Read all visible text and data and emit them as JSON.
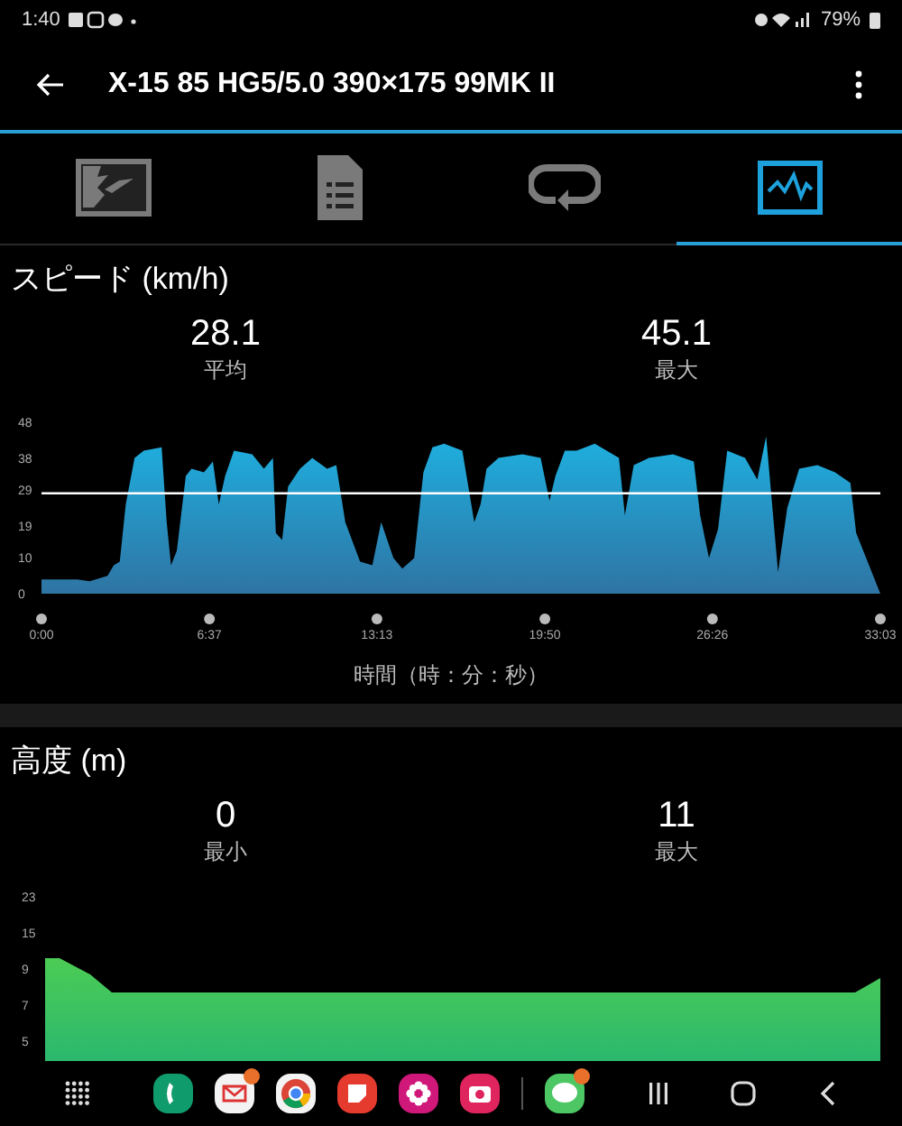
{
  "status_bar": {
    "time": "1:40",
    "battery": "79%"
  },
  "app_bar": {
    "title": "X-15 85 HG5/5.0 390×175 99MK II"
  },
  "tabs": [
    {
      "kind": "map",
      "selected": false
    },
    {
      "kind": "report",
      "selected": false
    },
    {
      "kind": "laps",
      "selected": false
    },
    {
      "kind": "graph",
      "selected": true
    }
  ],
  "speed": {
    "title": "スピード (km/h)",
    "stats": [
      {
        "value": "28.1",
        "label": "平均"
      },
      {
        "value": "45.1",
        "label": "最大"
      }
    ],
    "chart_data": {
      "type": "area",
      "xlabel": "時間（時：分：秒）",
      "x": [
        0,
        85,
        114,
        156,
        171,
        185,
        199,
        220,
        242,
        284,
        296,
        306,
        320,
        341,
        355,
        384,
        405,
        419,
        434,
        455,
        498,
        526,
        547,
        554,
        569,
        583,
        611,
        640,
        675,
        697,
        718,
        753,
        782,
        803,
        832,
        853,
        881,
        903,
        924,
        952,
        995,
        1009,
        1023,
        1038,
        1052,
        1080,
        1137,
        1180,
        1201,
        1215,
        1237,
        1265,
        1308,
        1365,
        1379,
        1400,
        1436,
        1493,
        1542,
        1557,
        1578,
        1599,
        1621,
        1663,
        1692,
        1713,
        1727,
        1741,
        1763,
        1791,
        1834,
        1876,
        1912,
        1926,
        1983
      ],
      "series": [
        {
          "color": "#1eb0e0",
          "values": [
            4,
            4,
            3.5,
            5,
            8,
            9,
            25,
            38,
            40,
            41,
            20,
            8,
            12,
            33,
            35,
            34,
            37,
            25,
            33,
            40,
            39,
            35,
            38,
            17,
            15,
            30,
            35,
            38,
            35,
            36,
            20,
            9,
            8,
            20,
            10,
            7,
            10,
            34,
            41,
            42,
            40,
            30,
            20,
            25,
            35,
            38,
            39,
            38,
            26,
            33,
            40,
            40,
            42,
            38,
            22,
            36,
            38,
            39,
            37,
            22,
            10,
            18,
            40,
            38,
            32,
            44,
            25,
            6,
            24,
            35,
            36,
            34,
            31,
            17,
            0
          ]
        }
      ],
      "ylim": [
        0,
        48
      ],
      "yticks": [
        0,
        10,
        19,
        29,
        38,
        48
      ],
      "xlim": [
        0,
        1983
      ],
      "xticks": [
        {
          "value": 0,
          "label": "0:00"
        },
        {
          "value": 397,
          "label": "6:37"
        },
        {
          "value": 793,
          "label": "13:13"
        },
        {
          "value": 1190,
          "label": "19:50"
        },
        {
          "value": 1586,
          "label": "26:26"
        },
        {
          "value": 1983,
          "label": "33:03"
        }
      ]
    }
  },
  "altitude": {
    "title": "高度 (m)",
    "stats": [
      {
        "value": "0",
        "label": "最小"
      },
      {
        "value": "11",
        "label": "最大"
      }
    ],
    "axis_labels": [
      "23",
      "15",
      "9",
      "7",
      "5"
    ]
  }
}
